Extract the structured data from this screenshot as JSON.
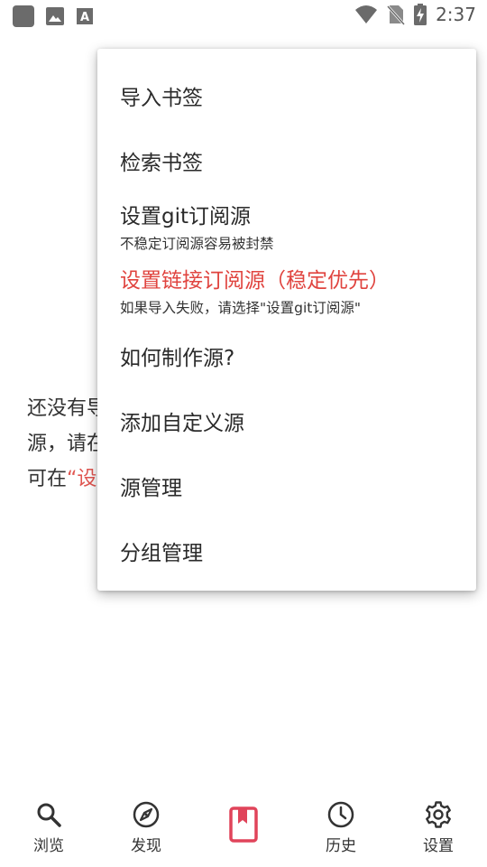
{
  "status_bar": {
    "time": "2:37",
    "left_icons": [
      "app-square-icon",
      "image-icon",
      "font-icon"
    ],
    "right_icons": [
      "wifi-icon",
      "no-sim-icon",
      "battery-charging-icon"
    ]
  },
  "background": {
    "line1": "还没有导",
    "line2": "源，请在",
    "line3_prefix": "可在",
    "line3_link": "“设"
  },
  "menu": {
    "items": [
      {
        "label": "导入书签"
      },
      {
        "label": "检索书签"
      },
      {
        "label": "设置git订阅源",
        "sub": "不稳定订阅源容易被封禁"
      },
      {
        "label": "设置链接订阅源（稳定优先）",
        "sub": "如果导入失败，请选择\"设置git订阅源\""
      },
      {
        "label": "如何制作源?"
      },
      {
        "label": "添加自定义源"
      },
      {
        "label": "源管理"
      },
      {
        "label": "分组管理"
      }
    ]
  },
  "bottom_nav": {
    "items": [
      {
        "label": "浏览",
        "icon": "search-icon"
      },
      {
        "label": "发现",
        "icon": "compass-icon"
      },
      {
        "label": "",
        "icon": "bookmark-icon",
        "active": true
      },
      {
        "label": "历史",
        "icon": "clock-icon"
      },
      {
        "label": "设置",
        "icon": "gear-icon"
      }
    ],
    "active_color": "#e0445a"
  },
  "colors": {
    "accent_red": "#e0443f"
  }
}
